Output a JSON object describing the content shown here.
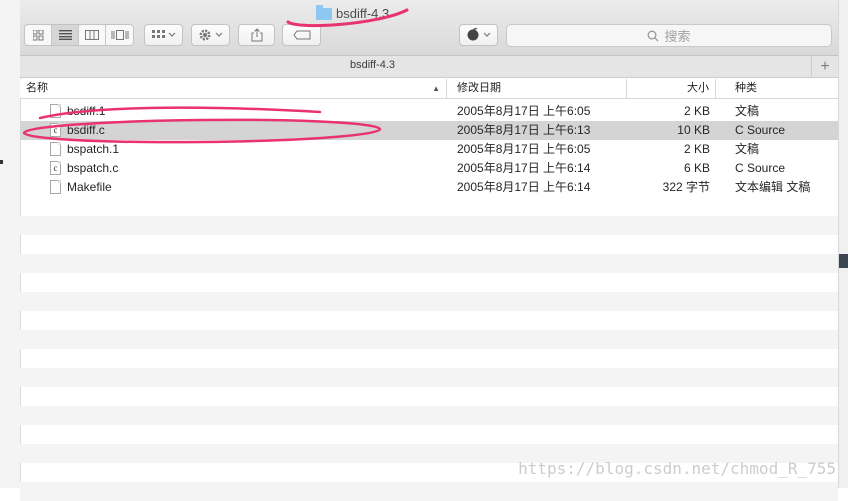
{
  "window": {
    "title": "bsdiff-4.3",
    "path_title": "bsdiff-4.3"
  },
  "toolbar": {
    "search_placeholder": "搜索",
    "search_icon": "magnifier-icon",
    "view_icons": [
      "icon-view-icon",
      "list-view-icon",
      "column-view-icon",
      "coverflow-view-icon"
    ],
    "arrange_icon": "arrange-icon",
    "action_icon": "gear-icon",
    "share_icon": "share-icon",
    "tag_icon": "tag-icon",
    "extension_icon": "extension-icon",
    "add_tab_label": "+"
  },
  "columns": {
    "name": "名称",
    "date": "修改日期",
    "size": "大小",
    "kind": "种类"
  },
  "files": [
    {
      "name": "bsdiff.1",
      "icon": "doc-icon",
      "icon_glyph": "",
      "date": "2005年8月17日 上午6:05",
      "size": "2 KB",
      "kind": "文稿"
    },
    {
      "name": "bsdiff.c",
      "icon": "c-file-icon",
      "icon_glyph": "c",
      "date": "2005年8月17日 上午6:13",
      "size": "10 KB",
      "kind": "C Source"
    },
    {
      "name": "bspatch.1",
      "icon": "doc-icon",
      "icon_glyph": "",
      "date": "2005年8月17日 上午6:05",
      "size": "2 KB",
      "kind": "文稿"
    },
    {
      "name": "bspatch.c",
      "icon": "c-file-icon",
      "icon_glyph": "c",
      "date": "2005年8月17日 上午6:14",
      "size": "6 KB",
      "kind": "C Source"
    },
    {
      "name": "Makefile",
      "icon": "doc-icon",
      "icon_glyph": "",
      "date": "2005年8月17日 上午6:14",
      "size": "322 字节",
      "kind": "文本编辑 文稿"
    }
  ],
  "selected_index": 1,
  "colors": {
    "annotation": "#e8336d",
    "selection": "#d4d4d4",
    "stripe": "#f4f4f4",
    "folder": "#8ec8f2"
  },
  "watermark": "https://blog.csdn.net/chmod_R_755"
}
